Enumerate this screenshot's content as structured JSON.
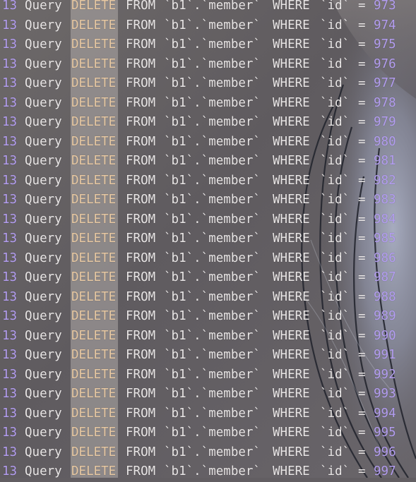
{
  "app": {
    "colors": {
      "text": "#e9e6e6",
      "number": "#b39df0",
      "selected_keyword": "#e7c8a2",
      "background": "#625e62"
    }
  },
  "rows": [
    {
      "thread": "13",
      "command": "Query",
      "keyword": "DELETE",
      "from": "FROM",
      "table": "`b1`.`member`",
      "where": "WHERE",
      "column": "`id`",
      "op": "=",
      "value": "973"
    },
    {
      "thread": "13",
      "command": "Query",
      "keyword": "DELETE",
      "from": "FROM",
      "table": "`b1`.`member`",
      "where": "WHERE",
      "column": "`id`",
      "op": "=",
      "value": "974"
    },
    {
      "thread": "13",
      "command": "Query",
      "keyword": "DELETE",
      "from": "FROM",
      "table": "`b1`.`member`",
      "where": "WHERE",
      "column": "`id`",
      "op": "=",
      "value": "975"
    },
    {
      "thread": "13",
      "command": "Query",
      "keyword": "DELETE",
      "from": "FROM",
      "table": "`b1`.`member`",
      "where": "WHERE",
      "column": "`id`",
      "op": "=",
      "value": "976"
    },
    {
      "thread": "13",
      "command": "Query",
      "keyword": "DELETE",
      "from": "FROM",
      "table": "`b1`.`member`",
      "where": "WHERE",
      "column": "`id`",
      "op": "=",
      "value": "977"
    },
    {
      "thread": "13",
      "command": "Query",
      "keyword": "DELETE",
      "from": "FROM",
      "table": "`b1`.`member`",
      "where": "WHERE",
      "column": "`id`",
      "op": "=",
      "value": "978"
    },
    {
      "thread": "13",
      "command": "Query",
      "keyword": "DELETE",
      "from": "FROM",
      "table": "`b1`.`member`",
      "where": "WHERE",
      "column": "`id`",
      "op": "=",
      "value": "979"
    },
    {
      "thread": "13",
      "command": "Query",
      "keyword": "DELETE",
      "from": "FROM",
      "table": "`b1`.`member`",
      "where": "WHERE",
      "column": "`id`",
      "op": "=",
      "value": "980"
    },
    {
      "thread": "13",
      "command": "Query",
      "keyword": "DELETE",
      "from": "FROM",
      "table": "`b1`.`member`",
      "where": "WHERE",
      "column": "`id`",
      "op": "=",
      "value": "981"
    },
    {
      "thread": "13",
      "command": "Query",
      "keyword": "DELETE",
      "from": "FROM",
      "table": "`b1`.`member`",
      "where": "WHERE",
      "column": "`id`",
      "op": "=",
      "value": "982"
    },
    {
      "thread": "13",
      "command": "Query",
      "keyword": "DELETE",
      "from": "FROM",
      "table": "`b1`.`member`",
      "where": "WHERE",
      "column": "`id`",
      "op": "=",
      "value": "983"
    },
    {
      "thread": "13",
      "command": "Query",
      "keyword": "DELETE",
      "from": "FROM",
      "table": "`b1`.`member`",
      "where": "WHERE",
      "column": "`id`",
      "op": "=",
      "value": "984"
    },
    {
      "thread": "13",
      "command": "Query",
      "keyword": "DELETE",
      "from": "FROM",
      "table": "`b1`.`member`",
      "where": "WHERE",
      "column": "`id`",
      "op": "=",
      "value": "985"
    },
    {
      "thread": "13",
      "command": "Query",
      "keyword": "DELETE",
      "from": "FROM",
      "table": "`b1`.`member`",
      "where": "WHERE",
      "column": "`id`",
      "op": "=",
      "value": "986"
    },
    {
      "thread": "13",
      "command": "Query",
      "keyword": "DELETE",
      "from": "FROM",
      "table": "`b1`.`member`",
      "where": "WHERE",
      "column": "`id`",
      "op": "=",
      "value": "987"
    },
    {
      "thread": "13",
      "command": "Query",
      "keyword": "DELETE",
      "from": "FROM",
      "table": "`b1`.`member`",
      "where": "WHERE",
      "column": "`id`",
      "op": "=",
      "value": "988"
    },
    {
      "thread": "13",
      "command": "Query",
      "keyword": "DELETE",
      "from": "FROM",
      "table": "`b1`.`member`",
      "where": "WHERE",
      "column": "`id`",
      "op": "=",
      "value": "989"
    },
    {
      "thread": "13",
      "command": "Query",
      "keyword": "DELETE",
      "from": "FROM",
      "table": "`b1`.`member`",
      "where": "WHERE",
      "column": "`id`",
      "op": "=",
      "value": "990"
    },
    {
      "thread": "13",
      "command": "Query",
      "keyword": "DELETE",
      "from": "FROM",
      "table": "`b1`.`member`",
      "where": "WHERE",
      "column": "`id`",
      "op": "=",
      "value": "991"
    },
    {
      "thread": "13",
      "command": "Query",
      "keyword": "DELETE",
      "from": "FROM",
      "table": "`b1`.`member`",
      "where": "WHERE",
      "column": "`id`",
      "op": "=",
      "value": "992"
    },
    {
      "thread": "13",
      "command": "Query",
      "keyword": "DELETE",
      "from": "FROM",
      "table": "`b1`.`member`",
      "where": "WHERE",
      "column": "`id`",
      "op": "=",
      "value": "993"
    },
    {
      "thread": "13",
      "command": "Query",
      "keyword": "DELETE",
      "from": "FROM",
      "table": "`b1`.`member`",
      "where": "WHERE",
      "column": "`id`",
      "op": "=",
      "value": "994"
    },
    {
      "thread": "13",
      "command": "Query",
      "keyword": "DELETE",
      "from": "FROM",
      "table": "`b1`.`member`",
      "where": "WHERE",
      "column": "`id`",
      "op": "=",
      "value": "995"
    },
    {
      "thread": "13",
      "command": "Query",
      "keyword": "DELETE",
      "from": "FROM",
      "table": "`b1`.`member`",
      "where": "WHERE",
      "column": "`id`",
      "op": "=",
      "value": "996"
    },
    {
      "thread": "13",
      "command": "Query",
      "keyword": "DELETE",
      "from": "FROM",
      "table": "`b1`.`member`",
      "where": "WHERE",
      "column": "`id`",
      "op": "=",
      "value": "997"
    }
  ]
}
